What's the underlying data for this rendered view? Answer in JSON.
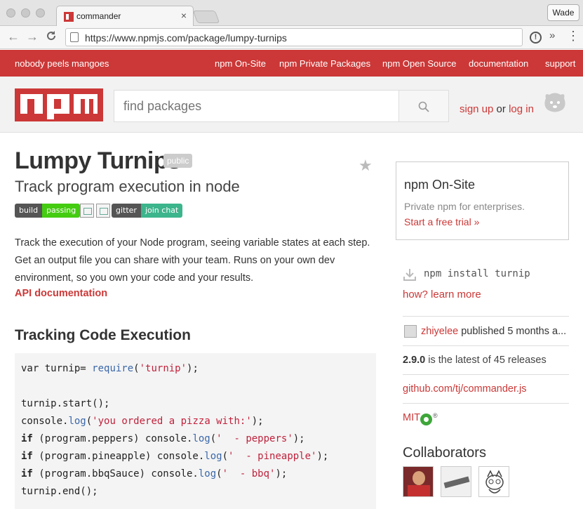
{
  "browser": {
    "tab_title": "commander",
    "tab_close": "×",
    "profile_button": "Wade",
    "url": "https://www.npmjs.com/package/lumpy-turnips",
    "back_icon": "←",
    "forward_icon": "→",
    "reload_icon": "C",
    "info_glyph": "!",
    "extensions_glyph": "»",
    "menu_glyph": "⋮"
  },
  "rednav": {
    "tagline": "nobody peels mangoes",
    "links": [
      "npm On-Site",
      "npm Private Packages",
      "npm Open Source",
      "documentation",
      "support"
    ]
  },
  "header": {
    "search_placeholder": "find packages",
    "signup": "sign up",
    "or": "or",
    "login": "log in"
  },
  "package": {
    "name": "Lumpy Turnips",
    "visibility": "public",
    "tagline": "Track program execution in node",
    "badges": {
      "build_label": "build",
      "build_status": "passing",
      "gitter_label": "gitter",
      "gitter_status": "join chat"
    },
    "description": "Track the execution of your Node program, seeing variable states at each step. Get an output file you can share with your team. Runs on your own dev environment, so you own your code and your results.",
    "api_link": "API documentation",
    "section_heading": "Tracking Code Execution"
  },
  "code": {
    "l1_a": "var turnip= ",
    "l1_fn": "require",
    "l1_b": "(",
    "l1_str": "'turnip'",
    "l1_c": ");",
    "l3": "turnip.start();",
    "l4_a": "console.",
    "l4_fn": "log",
    "l4_b": "(",
    "l4_str": "'you ordered a pizza with:'",
    "l4_c": ");",
    "kw_if": "if",
    "l5_a": " (program.peppers) console.",
    "l5_str": "'  - peppers'",
    "l6_a": " (program.pineapple) console.",
    "l6_str": "'  - pineapple'",
    "l7_a": " (program.bbqSauce) console.",
    "l7_str": "'  - bbq'",
    "log": "log",
    "open": "(",
    "close": ");",
    "l8": "turnip.end();"
  },
  "sidebar": {
    "onsite_title": "npm On-Site",
    "onsite_sub": "Private npm for enterprises.",
    "onsite_link": "Start a free trial »",
    "install_cmd": "npm install turnip",
    "how_link": "how? learn more",
    "publisher": "zhiyelee",
    "published_text": " published 5 months a...",
    "version": "2.9.0",
    "version_text": " is the latest of 45 releases",
    "repo": "github.com/tj/commander.js",
    "license": "MIT",
    "license_reg": "®",
    "collaborators_title": "Collaborators"
  },
  "icons": {
    "search": "search-icon",
    "star": "star-icon",
    "download": "download-icon"
  },
  "colors": {
    "brand_red": "#cb3837",
    "build_green": "#4c1",
    "gitter_teal": "#3cb48c"
  }
}
